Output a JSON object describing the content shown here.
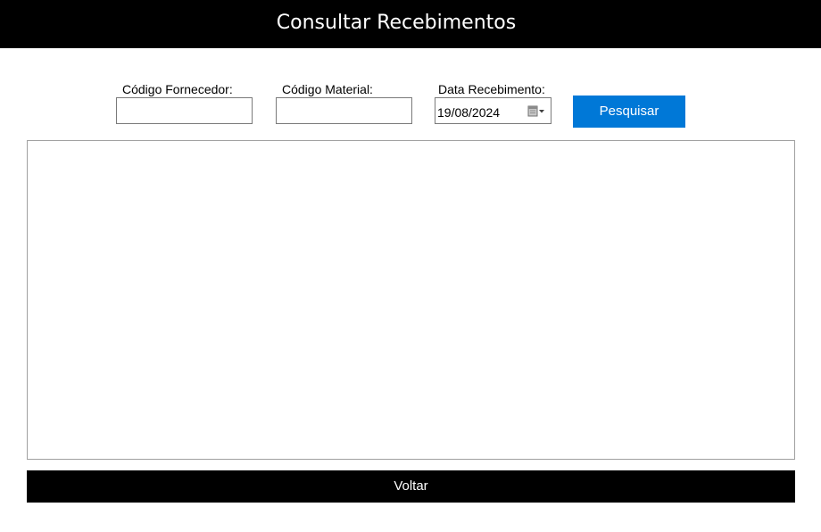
{
  "window": {
    "title": "Consultar Recebimentos"
  },
  "filters": {
    "supplier_code": {
      "label": "Código Fornecedor:",
      "value": ""
    },
    "material_code": {
      "label": "Código Material:",
      "value": ""
    },
    "receipt_date": {
      "label": "Data Recebimento:",
      "value": "19/08/2024",
      "icon": "calendar-dropdown-icon"
    },
    "search_label": "Pesquisar"
  },
  "results": {
    "rows": []
  },
  "footer": {
    "back_label": "Voltar"
  },
  "colors": {
    "header_bg": "#000000",
    "primary_button": "#0078d7",
    "back_button": "#000000"
  }
}
